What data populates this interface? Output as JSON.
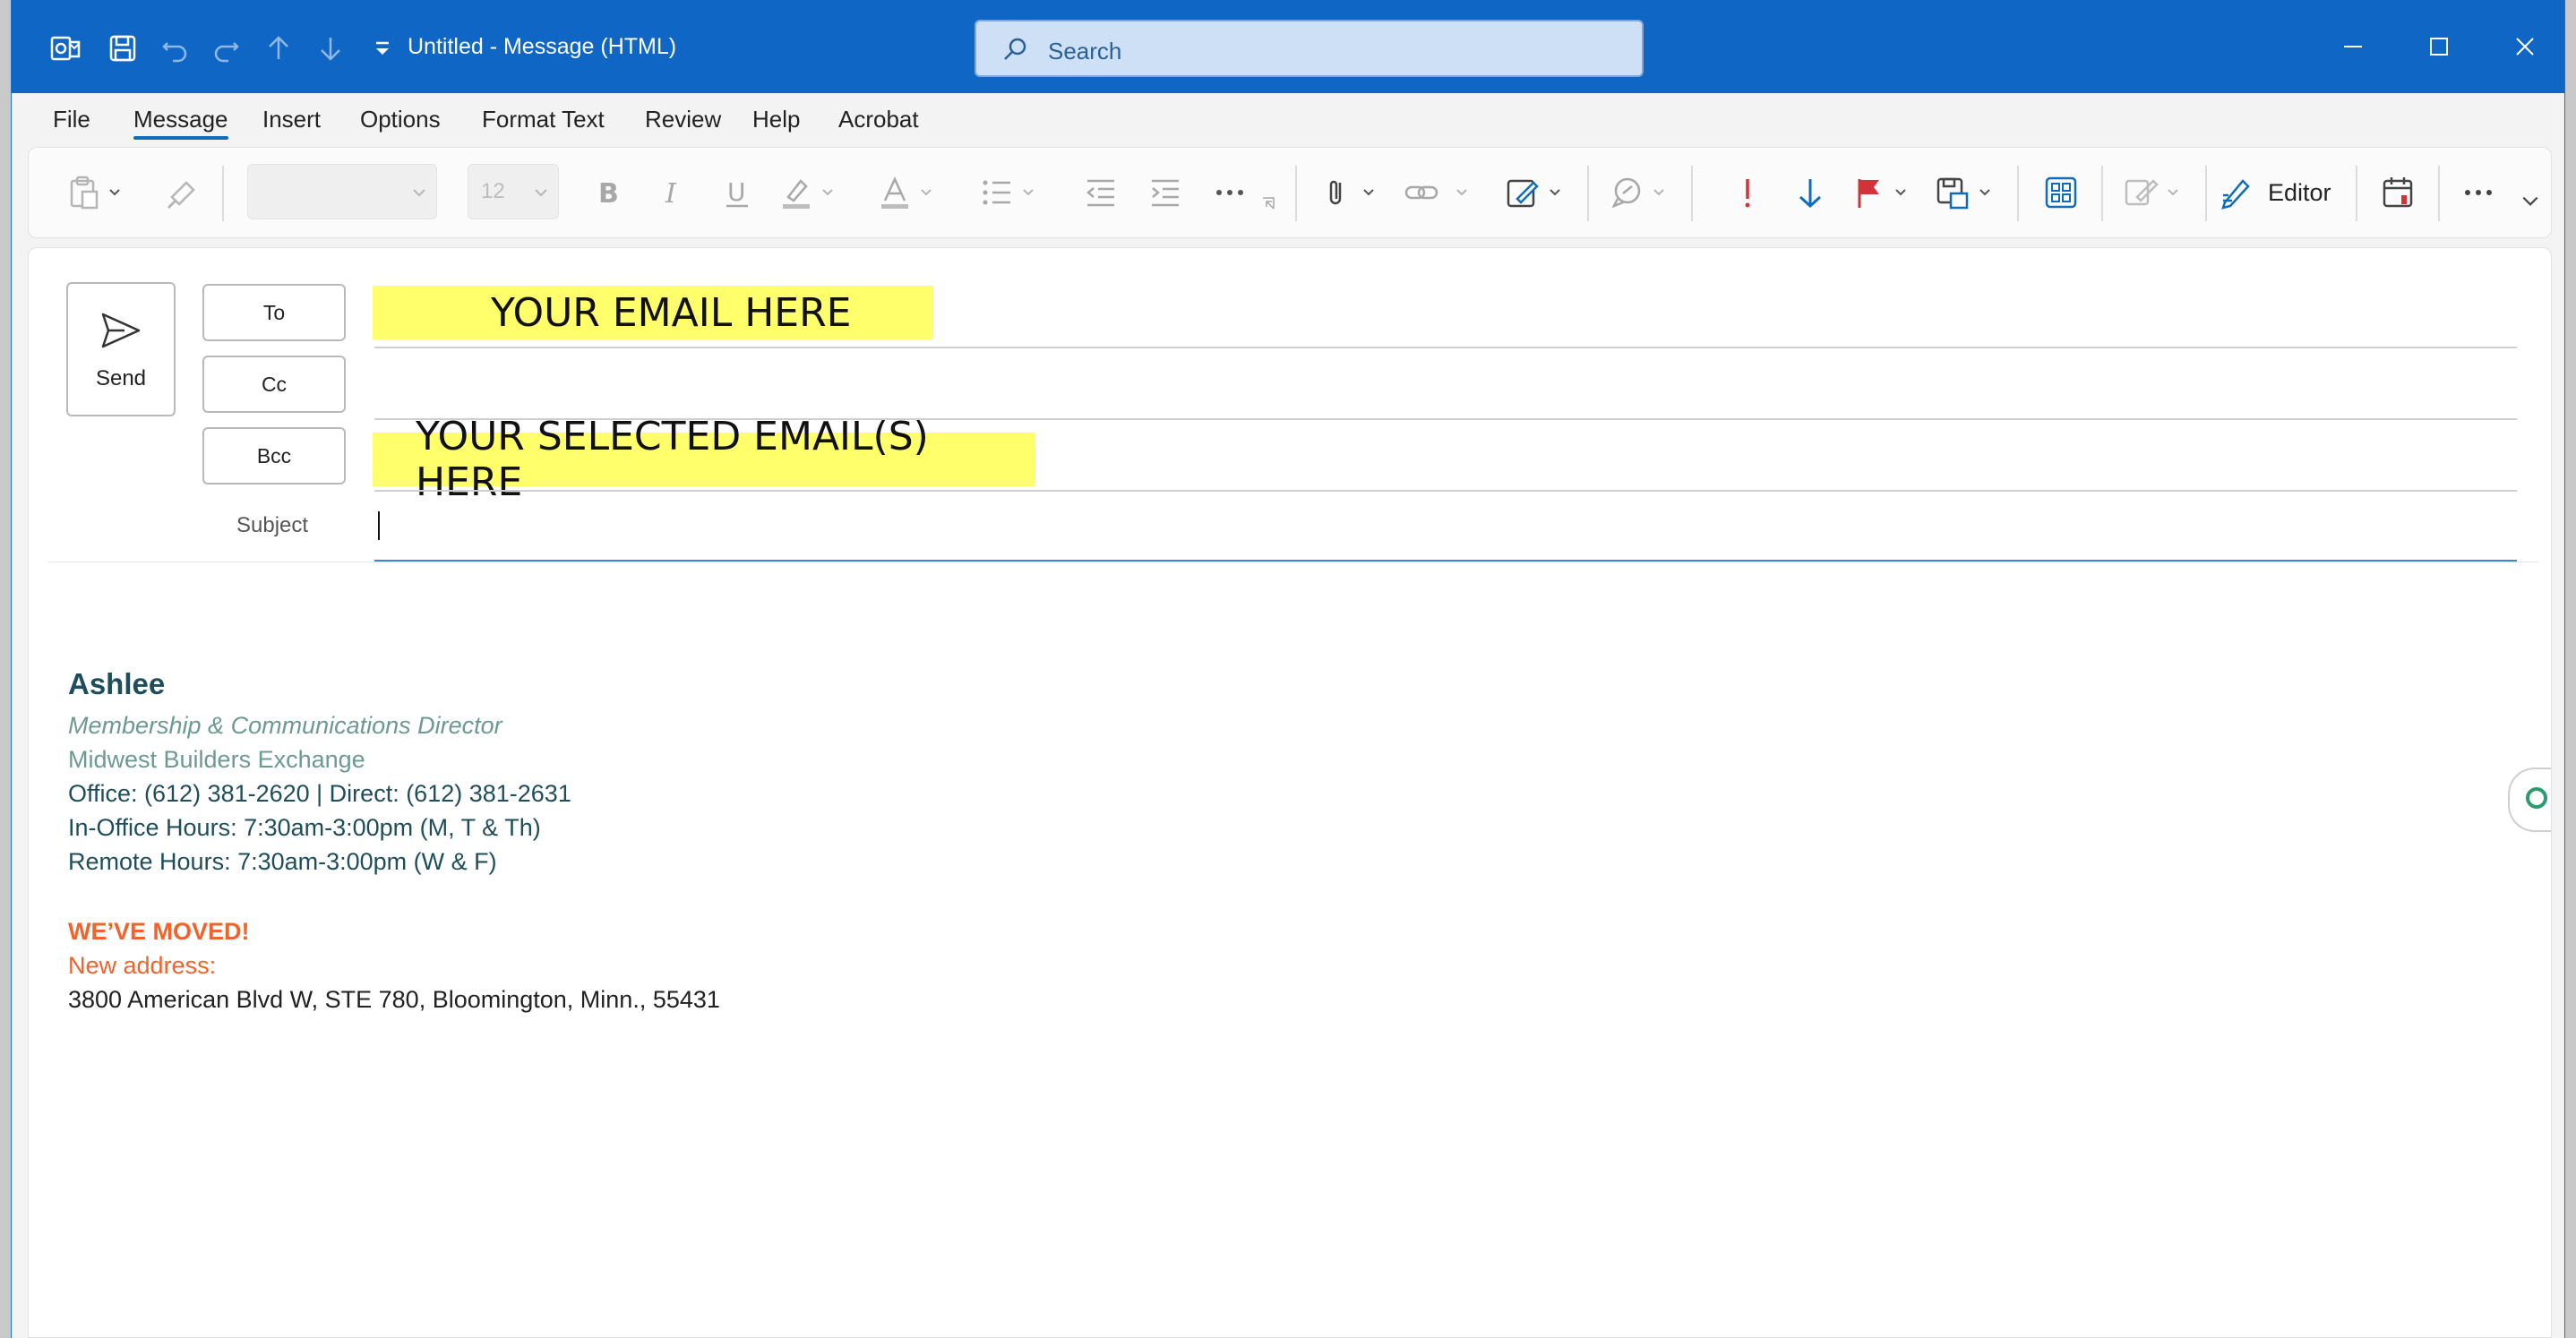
{
  "window": {
    "title": "Untitled  -  Message (HTML)",
    "search_placeholder": "Search"
  },
  "menu": {
    "items": [
      "File",
      "Message",
      "Insert",
      "Options",
      "Format Text",
      "Review",
      "Help",
      "Acrobat"
    ],
    "active": "Message"
  },
  "ribbon": {
    "font_name": "",
    "font_size": "12",
    "editor_label": "Editor"
  },
  "compose": {
    "send_label": "Send",
    "to_label": "To",
    "cc_label": "Cc",
    "bcc_label": "Bcc",
    "subject_label": "Subject",
    "to_value": "YOUR EMAIL HERE",
    "cc_value": "",
    "bcc_value": "YOUR SELECTED EMAIL(S) HERE",
    "subject_value": ""
  },
  "signature": {
    "name": "Ashlee",
    "role": "Membership & Communications Director",
    "company": "Midwest Builders Exchange",
    "phones": "Office: (612) 381-2620  |  Direct: (612) 381-2631",
    "office_hours": "In-Office Hours: 7:30am-3:00pm (M, T & Th)",
    "remote_hours": "Remote Hours: 7:30am-3:00pm (W & F)",
    "moved_heading": "WE’VE MOVED!",
    "new_address_label": "New address:",
    "address": "3800 American Blvd W, STE 780, Bloomington, Minn., 55431"
  },
  "colors": {
    "titlebar": "#1066c4",
    "accent": "#0f6cbd",
    "highlight": "#ffff6b",
    "signature_teal": "#1f4e5b",
    "signature_grey": "#6c9a90",
    "signature_orange": "#f2622b",
    "importance_red": "#d13438"
  }
}
